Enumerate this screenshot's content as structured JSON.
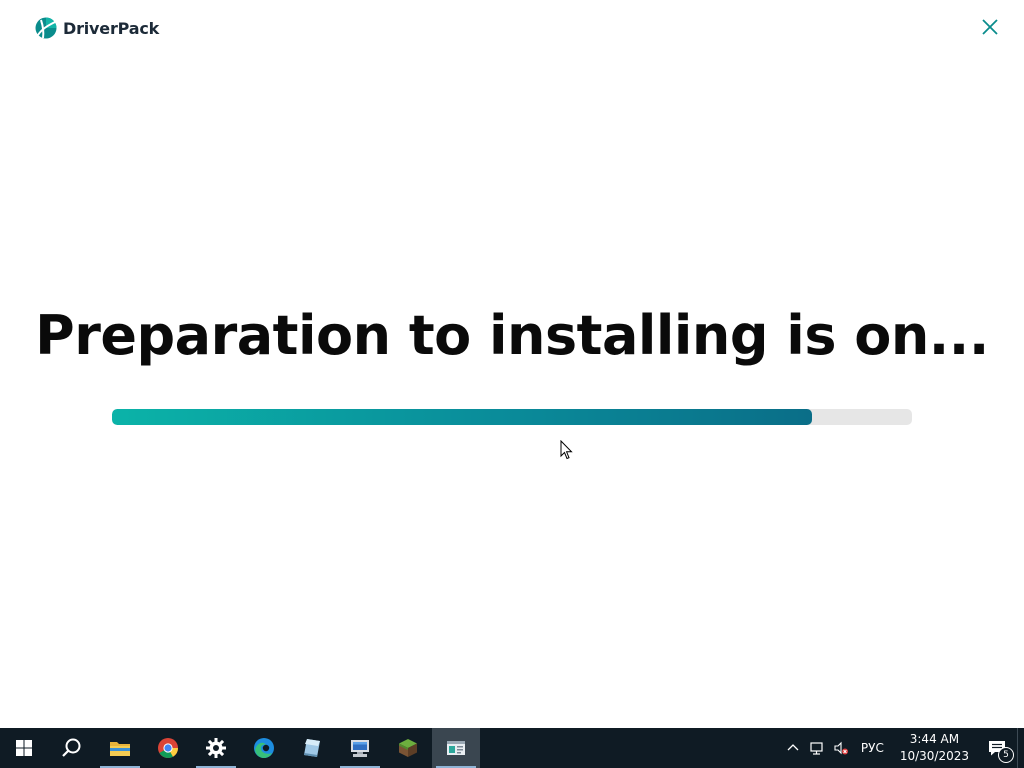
{
  "app": {
    "name": "DriverPack",
    "brand_color": "#0a8c8c",
    "close_icon": "close-icon"
  },
  "main": {
    "headline": "Preparation to installing is on...",
    "progress_fraction": 0.875,
    "progress_colors": [
      "#0bb3a8",
      "#0a6e88"
    ],
    "track_color": "#e6e6e6"
  },
  "taskbar": {
    "items": [
      {
        "name": "start-button",
        "icon": "windows-logo-icon"
      },
      {
        "name": "search-button",
        "icon": "search-icon"
      },
      {
        "name": "file-explorer",
        "icon": "folder-icon"
      },
      {
        "name": "chrome",
        "icon": "chrome-icon"
      },
      {
        "name": "settings",
        "icon": "gear-icon"
      },
      {
        "name": "edge",
        "icon": "edge-icon"
      },
      {
        "name": "app-glass",
        "icon": "glass-app-icon"
      },
      {
        "name": "app-computer",
        "icon": "computer-app-icon"
      },
      {
        "name": "app-minecraft",
        "icon": "grass-block-icon"
      },
      {
        "name": "app-driverpack",
        "icon": "window-app-icon"
      }
    ],
    "tray": {
      "language": "РУС",
      "time": "3:44 AM",
      "date": "10/30/2023",
      "notification_count": "5"
    }
  }
}
